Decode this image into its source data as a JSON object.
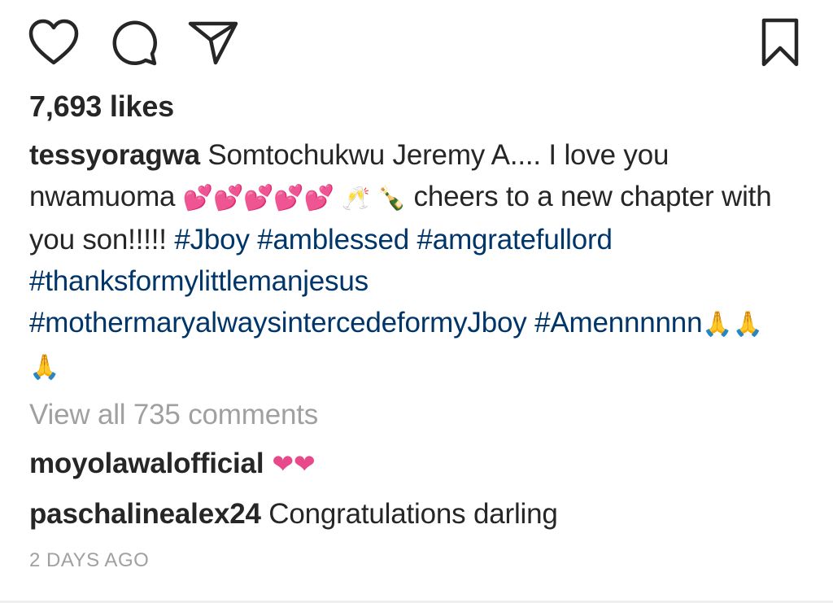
{
  "actions": {
    "like_icon": "heart-outline-icon",
    "comment_icon": "comment-bubble-icon",
    "share_icon": "paper-plane-icon",
    "save_icon": "bookmark-outline-icon"
  },
  "likes": "7,693 likes",
  "caption": {
    "username": "tessyoragwa",
    "text_1": " Somtochukwu Jeremy A.... I love you nwamuoma ",
    "hearts": "💕💕💕💕💕",
    "glasses": "🥂",
    "bottle": "🍾",
    "text_2": " cheers to a new chapter with you son!!!!! ",
    "hashtags": [
      "#Jboy",
      "#amblessed",
      "#amgratefullord",
      "#thanksformylittlemanjesus",
      "#mothermaryalwaysintercedeformyJboy",
      "#Amennnnnn"
    ],
    "pray": "🙏🙏🙏"
  },
  "view_all_comments": "View all 735 comments",
  "comments": [
    {
      "username": "moyolawalofficial",
      "text": " ❤❤"
    },
    {
      "username": "paschalinealex24",
      "text": " Congratulations darling"
    }
  ],
  "timestamp": "2 DAYS AGO",
  "colors": {
    "text": "#262626",
    "hashtag": "#003569",
    "muted": "#a0a0a0",
    "heart_pink": "#e8498a"
  }
}
